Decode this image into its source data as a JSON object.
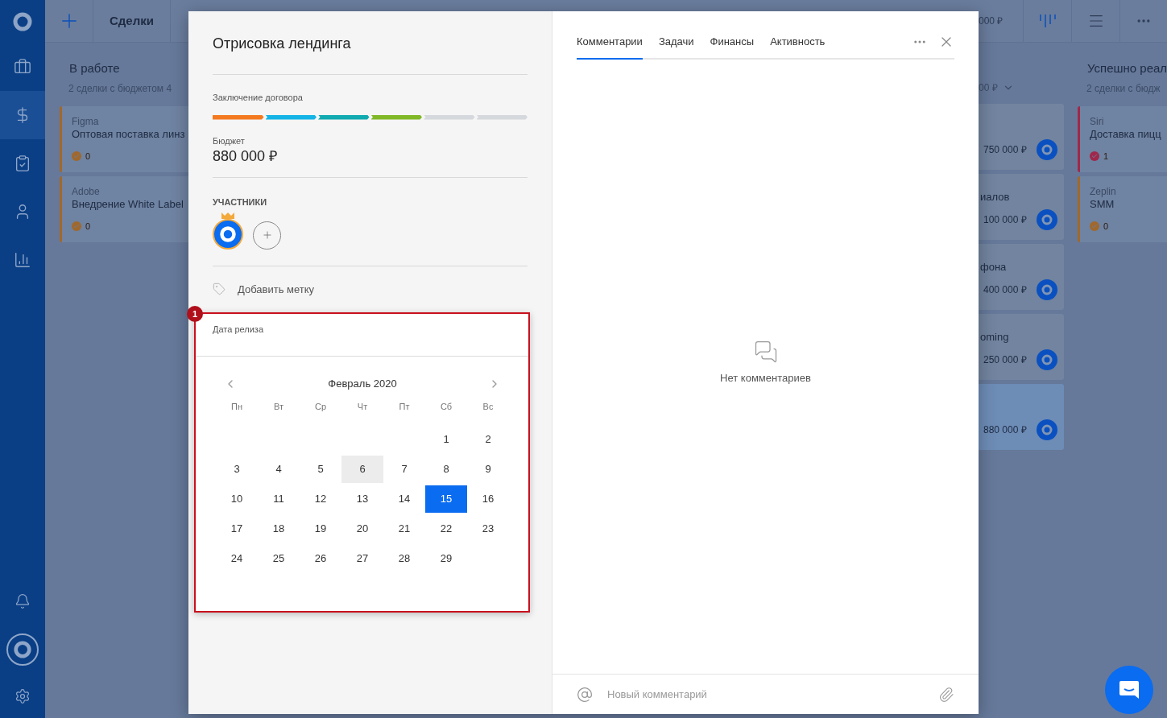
{
  "sidebar": {
    "items": [
      {
        "selected": false
      },
      {
        "selected": true
      },
      {
        "selected": false
      },
      {
        "selected": false
      },
      {
        "selected": false
      },
      {
        "selected": false
      }
    ]
  },
  "topbar": {
    "title": "Сделки",
    "total": "000 ₽"
  },
  "board": {
    "first_column": {
      "title": "В работе",
      "summary": "2 сделки с бюджетом 4",
      "cards": [
        {
          "company": "Figma",
          "title": "Оптовая поставка линз",
          "tasks": "0",
          "color": "#a0682c"
        },
        {
          "company": "Adobe",
          "title": "Внедрение White Label",
          "tasks": "0",
          "color": "#a0682c"
        }
      ]
    },
    "middle_column": {
      "summary": "00 ₽",
      "cards": [
        {
          "amount": "750 000 ₽",
          "selected": false
        },
        {
          "title": "иалов",
          "amount": "100 000 ₽",
          "selected": false
        },
        {
          "title": "фона",
          "amount": "400 000 ₽",
          "selected": false
        },
        {
          "title": "oming",
          "amount": "250 000 ₽",
          "selected": false
        },
        {
          "amount": "880 000 ₽",
          "selected": true
        }
      ]
    },
    "last_column": {
      "title": "Успешно реал",
      "summary": "2 сделки с бюдж",
      "cards": [
        {
          "company": "Siri",
          "title": "Доставка пицц",
          "tasks": "1",
          "color": "#a0284a"
        },
        {
          "company": "Zeplin",
          "title": "SMM",
          "tasks": "0",
          "color": "#a0682c"
        }
      ]
    }
  },
  "deal": {
    "title": "Отрисовка лендинга",
    "stage": "Заключение договора",
    "stages": [
      {
        "color": "#f47a20"
      },
      {
        "color": "#14b4e6"
      },
      {
        "color": "#10aab0"
      },
      {
        "color": "#80b828"
      },
      {
        "color": "#d5d8dc"
      },
      {
        "color": "#d5d8dc"
      }
    ],
    "budget_label": "Бюджет",
    "budget": "880 000 ₽",
    "participants_label": "УЧАСТНИКИ",
    "add_tag": "Добавить метку",
    "date_label": "Дата релиза",
    "marker": "1",
    "calendar": {
      "month": "Февраль 2020",
      "weekdays": [
        "Пн",
        "Вт",
        "Ср",
        "Чт",
        "Пт",
        "Сб",
        "Вс"
      ],
      "weeks": [
        {
          "kind": "lead",
          "days": [
            {
              "label": "1",
              "selected": false,
              "today": false
            },
            {
              "label": "2",
              "selected": false,
              "today": false
            }
          ]
        },
        {
          "kind": "full",
          "days": [
            {
              "label": "3",
              "selected": false,
              "today": false
            },
            {
              "label": "4",
              "selected": false,
              "today": false
            },
            {
              "label": "5",
              "selected": false,
              "today": false
            },
            {
              "label": "6",
              "selected": false,
              "today": true
            },
            {
              "label": "7",
              "selected": false,
              "today": false
            },
            {
              "label": "8",
              "selected": false,
              "today": false
            },
            {
              "label": "9",
              "selected": false,
              "today": false
            }
          ]
        },
        {
          "kind": "full",
          "days": [
            {
              "label": "10",
              "selected": false,
              "today": false
            },
            {
              "label": "11",
              "selected": false,
              "today": false
            },
            {
              "label": "12",
              "selected": false,
              "today": false
            },
            {
              "label": "13",
              "selected": false,
              "today": false
            },
            {
              "label": "14",
              "selected": false,
              "today": false
            },
            {
              "label": "15",
              "selected": true,
              "today": false
            },
            {
              "label": "16",
              "selected": false,
              "today": false
            }
          ]
        },
        {
          "kind": "full",
          "days": [
            {
              "label": "17",
              "selected": false,
              "today": false
            },
            {
              "label": "18",
              "selected": false,
              "today": false
            },
            {
              "label": "19",
              "selected": false,
              "today": false
            },
            {
              "label": "20",
              "selected": false,
              "today": false
            },
            {
              "label": "21",
              "selected": false,
              "today": false
            },
            {
              "label": "22",
              "selected": false,
              "today": false
            },
            {
              "label": "23",
              "selected": false,
              "today": false
            }
          ]
        },
        {
          "kind": "tail",
          "days": [
            {
              "label": "24",
              "selected": false,
              "today": false
            },
            {
              "label": "25",
              "selected": false,
              "today": false
            },
            {
              "label": "26",
              "selected": false,
              "today": false
            },
            {
              "label": "27",
              "selected": false,
              "today": false
            },
            {
              "label": "28",
              "selected": false,
              "today": false
            },
            {
              "label": "29",
              "selected": false,
              "today": false
            }
          ]
        }
      ]
    }
  },
  "comments": {
    "tabs": [
      {
        "label": "Комментарии",
        "selected": true
      },
      {
        "label": "Задачи",
        "selected": false
      },
      {
        "label": "Финансы",
        "selected": false
      },
      {
        "label": "Активность",
        "selected": false
      }
    ],
    "empty": "Нет комментариев",
    "placeholder": "Новый комментарий"
  }
}
